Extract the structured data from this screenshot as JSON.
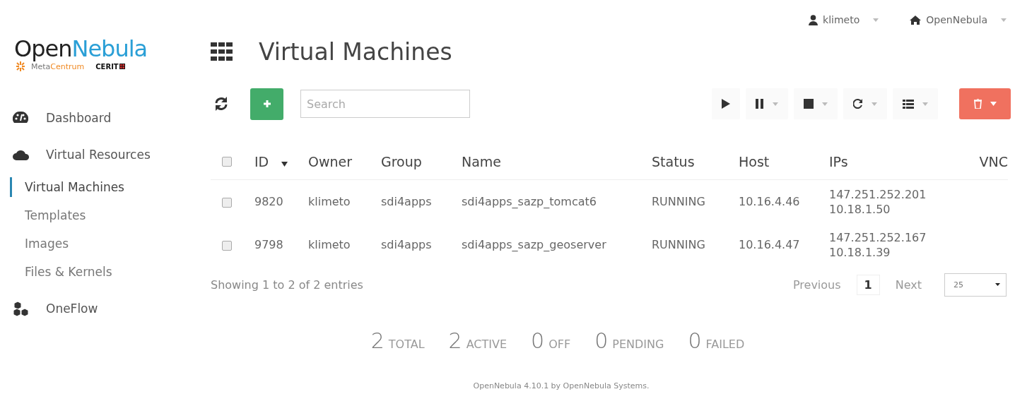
{
  "logo": {
    "title": [
      "Open",
      "Nebula"
    ],
    "partner": [
      "Meta",
      "Centrum"
    ],
    "partner_2": "CERIT"
  },
  "top_menu": [
    {
      "label": "klimeto"
    },
    {
      "label": "OpenNebula"
    }
  ],
  "sidebar": {
    "items": [
      {
        "label": "Dashboard",
        "kind": "section",
        "selected": false
      },
      {
        "label": "Virtual Resources",
        "kind": "section",
        "selected": false
      },
      {
        "label": "Virtual Machines",
        "kind": "sub",
        "selected": true
      },
      {
        "label": "Templates",
        "kind": "sub",
        "selected": false
      },
      {
        "label": "Images",
        "kind": "sub",
        "selected": false
      },
      {
        "label": "Files & Kernels",
        "kind": "sub",
        "selected": false
      },
      {
        "label": "OneFlow",
        "kind": "section",
        "selected": false
      }
    ]
  },
  "page_title": "Virtual Machines",
  "search": {
    "placeholder": "Search"
  },
  "table": {
    "select_all": {
      "checked": false
    },
    "columns": [
      {
        "label": "ID",
        "sorted": true
      },
      {
        "label": "Owner",
        "sorted": false
      },
      {
        "label": "Group",
        "sorted": false
      },
      {
        "label": "Name",
        "sorted": false
      },
      {
        "label": "Status",
        "sorted": false
      },
      {
        "label": "Host",
        "sorted": false
      },
      {
        "label": "IPs",
        "sorted": false
      },
      {
        "label": "VNC",
        "sorted": false
      }
    ],
    "rows": [
      {
        "checked": false,
        "id": "9820",
        "owner": "klimeto",
        "group": "sdi4apps",
        "name": "sdi4apps_sazp_tomcat6",
        "status": "RUNNING",
        "host": "10.16.4.46",
        "ips": [
          "147.251.252.201",
          "10.18.1.50"
        ]
      },
      {
        "checked": false,
        "id": "9798",
        "owner": "klimeto",
        "group": "sdi4apps",
        "name": "sdi4apps_sazp_geoserver",
        "status": "RUNNING",
        "host": "10.16.4.47",
        "ips": [
          "147.251.252.167",
          "10.18.1.39"
        ]
      }
    ]
  },
  "table_info": "Showing 1 to 2 of 2 entries",
  "pagination": {
    "previous": "Previous",
    "pages": [
      {
        "label": "1",
        "selected": true
      }
    ],
    "next": "Next",
    "page_size": "25"
  },
  "stats": [
    {
      "value": "2",
      "label": "TOTAL"
    },
    {
      "value": "2",
      "label": "ACTIVE"
    },
    {
      "value": "0",
      "label": "OFF"
    },
    {
      "value": "0",
      "label": "PENDING"
    },
    {
      "value": "0",
      "label": "FAILED"
    }
  ],
  "footer": "OpenNebula 4.10.1 by OpenNebula Systems."
}
